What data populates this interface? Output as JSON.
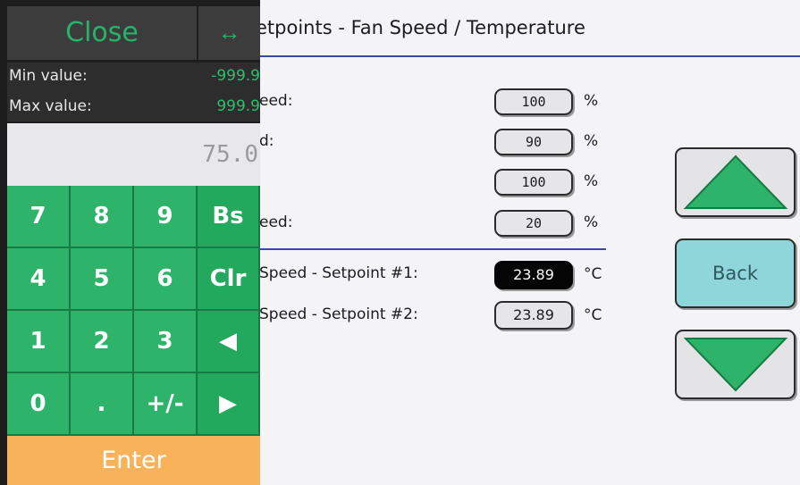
{
  "screen": {
    "title": "etpoints - Fan Speed / Temperature",
    "rows": [
      {
        "label": "eed:",
        "value": "100",
        "unit": "%"
      },
      {
        "label": "d:",
        "value": "90",
        "unit": "%"
      },
      {
        "label": "",
        "value": "100",
        "unit": "%"
      },
      {
        "label": "eed:",
        "value": "20",
        "unit": "%"
      }
    ],
    "temps": [
      {
        "label": "Speed - Setpoint #1:",
        "value": "23.89",
        "unit": "°C",
        "active": true
      },
      {
        "label": "Speed - Setpoint #2:",
        "value": "23.89",
        "unit": "°C",
        "active": false
      }
    ],
    "nav": {
      "back_label": "Back",
      "up_icon": "triangle-up-icon",
      "down_icon": "triangle-down-icon"
    }
  },
  "keypad": {
    "close_label": "Close",
    "move_icon": "↔",
    "min_label": "Min value:",
    "min_value": "-999.9",
    "max_label": "Max value:",
    "max_value": "999.9",
    "display": "75.0",
    "keys": [
      [
        "7",
        "8",
        "9",
        "Bs"
      ],
      [
        "4",
        "5",
        "6",
        "Clr"
      ],
      [
        "1",
        "2",
        "3",
        "◀"
      ],
      [
        "0",
        ".",
        "+/-",
        "▶"
      ]
    ],
    "enter_label": "Enter"
  },
  "colors": {
    "accent_green": "#2eb36a",
    "enter_orange": "#f7b25a",
    "rule_blue": "#3b47a8",
    "back_cyan": "#8fd6db"
  }
}
